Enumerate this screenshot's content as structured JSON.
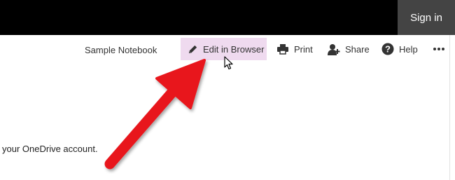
{
  "header": {
    "sign_in_label": "Sign in"
  },
  "toolbar": {
    "notebook_name": "Sample Notebook",
    "edit_label": "Edit in Browser",
    "print_label": "Print",
    "share_label": "Share",
    "help_label": "Help",
    "more_icon": "ellipsis-icon"
  },
  "content": {
    "text": "your OneDrive account."
  },
  "annotation": {
    "arrow_color": "#e8141c"
  },
  "colors": {
    "highlight": "#efdaef",
    "topbar": "#000000",
    "signin_bg": "#444444"
  }
}
